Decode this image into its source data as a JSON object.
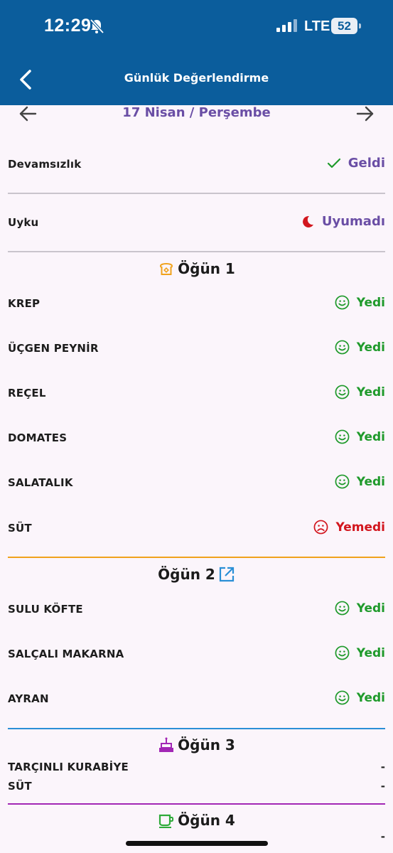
{
  "status_bar": {
    "time": "12:29",
    "network": "LTE",
    "battery": "52",
    "icons": [
      "bell-slash-icon",
      "signal-icon",
      "battery-icon"
    ]
  },
  "header": {
    "title": "Günlük Değerlendirme",
    "back_icon": "chevron-left-icon",
    "background": "#0b5d9c"
  },
  "date_nav": {
    "date": "17 Nisan / Perşembe",
    "prev_icon": "arrow-left-icon",
    "next_icon": "arrow-right-icon"
  },
  "attendance": {
    "label": "Devamsızlık",
    "value": "Geldi",
    "icon": "check-icon"
  },
  "sleep": {
    "label": "Uyku",
    "value": "Uyumadı",
    "icon": "moon-icon"
  },
  "meals": [
    {
      "title": "Öğün 1",
      "icon": "bread-icon",
      "color": "#f0a21c",
      "items": [
        {
          "name": "KREP",
          "status": "Yedi"
        },
        {
          "name": "ÜÇGEN PEYNİR",
          "status": "Yedi"
        },
        {
          "name": "REÇEL",
          "status": "Yedi"
        },
        {
          "name": "DOMATES",
          "status": "Yedi"
        },
        {
          "name": "SALATALIK",
          "status": "Yedi"
        },
        {
          "name": "SÜT",
          "status": "Yemedi"
        }
      ]
    },
    {
      "title": "Öğün 2",
      "icon": "external-link-icon",
      "color": "#2a8fd6",
      "items": [
        {
          "name": "SULU KÖFTE",
          "status": "Yedi"
        },
        {
          "name": "SALÇALI MAKARNA",
          "status": "Yedi"
        },
        {
          "name": "AYRAN",
          "status": "Yedi"
        }
      ]
    },
    {
      "title": "Öğün 3",
      "icon": "cake-icon",
      "color": "#a227b5",
      "items": [
        {
          "name": "TARÇINLI KURABİYE",
          "status": "-"
        },
        {
          "name": "SÜT",
          "status": "-"
        }
      ]
    },
    {
      "title": "Öğün 4",
      "icon": "cup-icon",
      "color": "#2eaa3a",
      "items": [
        {
          "name": "",
          "status": "-"
        }
      ]
    }
  ],
  "colors": {
    "ate": "#1f9a2b",
    "not_ate": "#d2161e",
    "accent": "#6a4ea5"
  }
}
